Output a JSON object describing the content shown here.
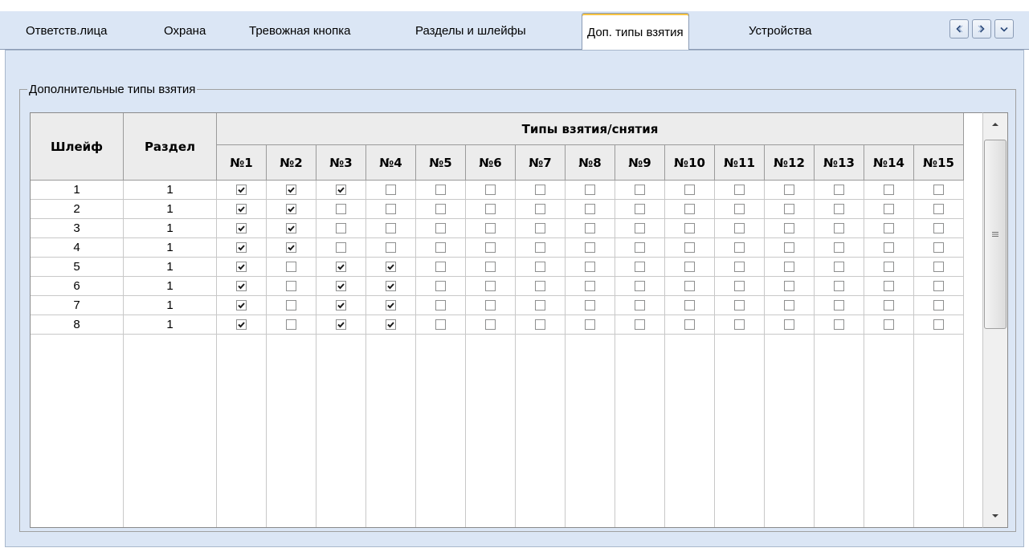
{
  "tabs": [
    {
      "label": "Ответств.лица",
      "active": false
    },
    {
      "label": "Охрана",
      "active": false
    },
    {
      "label": "Тревожная кнопка",
      "active": false
    },
    {
      "label": "Разделы и шлейфы",
      "active": false
    },
    {
      "label": "Доп. типы взятия",
      "active": true
    },
    {
      "label": "Устройства",
      "active": false
    }
  ],
  "nav_buttons": [
    "chevron-left-icon",
    "chevron-right-icon",
    "chevron-down-icon"
  ],
  "group": {
    "title": "Дополнительные типы взятия"
  },
  "grid": {
    "col_loop": "Шлейф",
    "col_section": "Раздел",
    "group_header": "Типы взятия/снятия",
    "type_columns": [
      "№1",
      "№2",
      "№3",
      "№4",
      "№5",
      "№6",
      "№7",
      "№8",
      "№9",
      "№10",
      "№11",
      "№12",
      "№13",
      "№14",
      "№15"
    ],
    "rows": [
      {
        "loop": "1",
        "section": "1",
        "checks": [
          1,
          1,
          1,
          0,
          0,
          0,
          0,
          0,
          0,
          0,
          0,
          0,
          0,
          0,
          0
        ]
      },
      {
        "loop": "2",
        "section": "1",
        "checks": [
          1,
          1,
          0,
          0,
          0,
          0,
          0,
          0,
          0,
          0,
          0,
          0,
          0,
          0,
          0
        ]
      },
      {
        "loop": "3",
        "section": "1",
        "checks": [
          1,
          1,
          0,
          0,
          0,
          0,
          0,
          0,
          0,
          0,
          0,
          0,
          0,
          0,
          0
        ]
      },
      {
        "loop": "4",
        "section": "1",
        "checks": [
          1,
          1,
          0,
          0,
          0,
          0,
          0,
          0,
          0,
          0,
          0,
          0,
          0,
          0,
          0
        ]
      },
      {
        "loop": "5",
        "section": "1",
        "checks": [
          1,
          0,
          1,
          1,
          0,
          0,
          0,
          0,
          0,
          0,
          0,
          0,
          0,
          0,
          0
        ]
      },
      {
        "loop": "6",
        "section": "1",
        "checks": [
          1,
          0,
          1,
          1,
          0,
          0,
          0,
          0,
          0,
          0,
          0,
          0,
          0,
          0,
          0
        ]
      },
      {
        "loop": "7",
        "section": "1",
        "checks": [
          1,
          0,
          1,
          1,
          0,
          0,
          0,
          0,
          0,
          0,
          0,
          0,
          0,
          0,
          0
        ]
      },
      {
        "loop": "8",
        "section": "1",
        "checks": [
          1,
          0,
          1,
          1,
          0,
          0,
          0,
          0,
          0,
          0,
          0,
          0,
          0,
          0,
          0
        ]
      }
    ]
  },
  "colors": {
    "panel_bg": "#dbe6f5",
    "active_tab_accent": "#f6c343"
  }
}
